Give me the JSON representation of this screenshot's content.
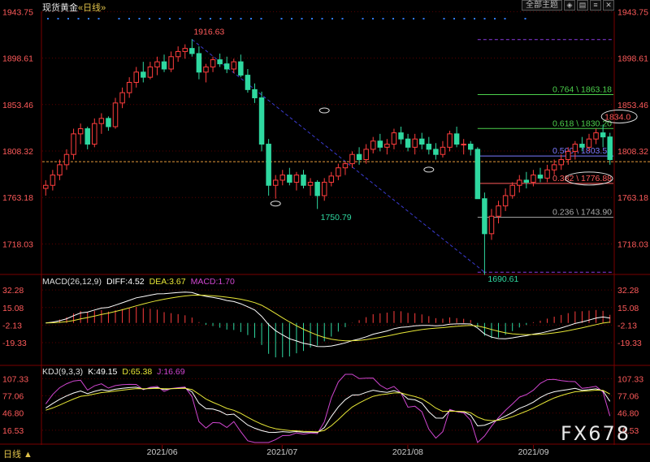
{
  "header": {
    "instrument": "现货黄金",
    "period": "«日线»",
    "menu_label": "全部主题",
    "icons": [
      "adjust-icon",
      "layers-icon",
      "menu-icon",
      "close-icon"
    ]
  },
  "colors": {
    "up": "#ff3d3d",
    "down": "#2fd8a0",
    "price_axis": "#ff5a5a",
    "grid": "#5a0000",
    "trend": "#3b3bd0",
    "dashed_ref": "#e59a3a",
    "diff": "#ffffff",
    "dea": "#e8e837",
    "macd": "#d046d0",
    "k": "#ffffff",
    "d": "#e8e837",
    "j": "#d046d0"
  },
  "chart_data": [
    {
      "type": "candlestick",
      "title": "现货黄金 «日线»",
      "y_ticks": [
        "1943.75",
        "1898.61",
        "1853.46",
        "1808.32",
        "1763.18",
        "1718.03"
      ],
      "x_ticks": [
        "2021/06",
        "2021/07",
        "2021/08",
        "2021/09"
      ],
      "ylim": [
        1690,
        1944
      ],
      "candles": [
        [
          1772,
          1780,
          1765,
          1775
        ],
        [
          1775,
          1790,
          1770,
          1785
        ],
        [
          1785,
          1800,
          1780,
          1795
        ],
        [
          1795,
          1810,
          1790,
          1805
        ],
        [
          1805,
          1830,
          1800,
          1825
        ],
        [
          1825,
          1835,
          1815,
          1830
        ],
        [
          1830,
          1832,
          1810,
          1815
        ],
        [
          1815,
          1840,
          1812,
          1835
        ],
        [
          1835,
          1845,
          1825,
          1840
        ],
        [
          1840,
          1842,
          1828,
          1832
        ],
        [
          1832,
          1860,
          1830,
          1855
        ],
        [
          1855,
          1870,
          1850,
          1865
        ],
        [
          1865,
          1880,
          1860,
          1875
        ],
        [
          1875,
          1890,
          1870,
          1885
        ],
        [
          1885,
          1895,
          1875,
          1880
        ],
        [
          1880,
          1895,
          1878,
          1890
        ],
        [
          1890,
          1900,
          1882,
          1895
        ],
        [
          1895,
          1902,
          1885,
          1888
        ],
        [
          1888,
          1905,
          1885,
          1900
        ],
        [
          1900,
          1910,
          1895,
          1905
        ],
        [
          1905,
          1912,
          1898,
          1908
        ],
        [
          1908,
          1917,
          1900,
          1903
        ],
        [
          1903,
          1910,
          1878,
          1885
        ],
        [
          1885,
          1893,
          1875,
          1890
        ],
        [
          1890,
          1900,
          1885,
          1897
        ],
        [
          1897,
          1903,
          1890,
          1893
        ],
        [
          1893,
          1900,
          1884,
          1888
        ],
        [
          1888,
          1898,
          1884,
          1895
        ],
        [
          1895,
          1902,
          1880,
          1882
        ],
        [
          1882,
          1888,
          1865,
          1868
        ],
        [
          1868,
          1874,
          1855,
          1860
        ],
        [
          1860,
          1866,
          1808,
          1815
        ],
        [
          1815,
          1820,
          1765,
          1775
        ],
        [
          1775,
          1785,
          1762,
          1780
        ],
        [
          1780,
          1790,
          1775,
          1785
        ],
        [
          1785,
          1792,
          1775,
          1778
        ],
        [
          1778,
          1788,
          1770,
          1785
        ],
        [
          1785,
          1790,
          1772,
          1775
        ],
        [
          1775,
          1782,
          1765,
          1778
        ],
        [
          1778,
          1780,
          1752,
          1765
        ],
        [
          1765,
          1782,
          1760,
          1778
        ],
        [
          1778,
          1788,
          1774,
          1784
        ],
        [
          1784,
          1796,
          1780,
          1792
        ],
        [
          1792,
          1798,
          1785,
          1796
        ],
        [
          1796,
          1808,
          1792,
          1805
        ],
        [
          1805,
          1812,
          1795,
          1800
        ],
        [
          1800,
          1815,
          1796,
          1810
        ],
        [
          1810,
          1822,
          1806,
          1818
        ],
        [
          1818,
          1825,
          1808,
          1812
        ],
        [
          1812,
          1820,
          1805,
          1815
        ],
        [
          1815,
          1830,
          1810,
          1826
        ],
        [
          1826,
          1832,
          1815,
          1820
        ],
        [
          1820,
          1825,
          1808,
          1812
        ],
        [
          1812,
          1825,
          1805,
          1820
        ],
        [
          1820,
          1826,
          1810,
          1815
        ],
        [
          1815,
          1822,
          1805,
          1810
        ],
        [
          1810,
          1816,
          1800,
          1805
        ],
        [
          1805,
          1818,
          1802,
          1812
        ],
        [
          1812,
          1828,
          1808,
          1825
        ],
        [
          1825,
          1832,
          1812,
          1815
        ],
        [
          1815,
          1820,
          1805,
          1815
        ],
        [
          1815,
          1818,
          1804,
          1810
        ],
        [
          1810,
          1812,
          1770,
          1762
        ],
        [
          1762,
          1768,
          1688,
          1728
        ],
        [
          1728,
          1752,
          1722,
          1745
        ],
        [
          1745,
          1760,
          1738,
          1755
        ],
        [
          1755,
          1772,
          1750,
          1765
        ],
        [
          1765,
          1778,
          1762,
          1775
        ],
        [
          1775,
          1785,
          1768,
          1780
        ],
        [
          1780,
          1788,
          1772,
          1778
        ],
        [
          1778,
          1790,
          1774,
          1785
        ],
        [
          1785,
          1792,
          1778,
          1782
        ],
        [
          1782,
          1795,
          1778,
          1790
        ],
        [
          1790,
          1800,
          1785,
          1795
        ],
        [
          1795,
          1805,
          1790,
          1800
        ],
        [
          1800,
          1812,
          1795,
          1808
        ],
        [
          1808,
          1818,
          1800,
          1815
        ],
        [
          1815,
          1822,
          1808,
          1812
        ],
        [
          1812,
          1825,
          1808,
          1820
        ],
        [
          1820,
          1830,
          1815,
          1826
        ],
        [
          1826,
          1834,
          1812,
          1822
        ],
        [
          1822,
          1826,
          1795,
          1800
        ]
      ],
      "labels": [
        {
          "text": "1916.63",
          "price": 1916.63,
          "index": 21,
          "color": "#ff5a5a"
        },
        {
          "text": "1750.79",
          "price": 1750.79,
          "index": 39,
          "color": "#2fd8a0"
        },
        {
          "text": "1690.61",
          "price": 1690.61,
          "index": 63,
          "color": "#2fd8a0"
        },
        {
          "text": "1834.0",
          "price": 1834.0,
          "index": 80,
          "color": "#ff5a5a"
        }
      ],
      "fibonacci": [
        {
          "ratio": "0.764",
          "price": "1863.18",
          "text": "0.764 \\ 1863.18",
          "value": 1863.18,
          "color": "#4cd04c"
        },
        {
          "ratio": "0.618",
          "price": "1830.20",
          "text": "0.618 \\ 1830.20",
          "value": 1830.2,
          "color": "#4cd04c"
        },
        {
          "ratio": "0.500",
          "price": "1803.54",
          "text": "0.500 \\ 1803.54",
          "value": 1803.54,
          "color": "#7a7aff"
        },
        {
          "ratio": "0.382",
          "price": "1776.88",
          "text": "0.382 \\ 1776.88",
          "value": 1776.88,
          "color": "#ff5a5a"
        },
        {
          "ratio": "0.236",
          "price": "1743.90",
          "text": "0.236 \\ 1743.90",
          "value": 1743.9,
          "color": "#aaaaaa"
        }
      ],
      "fib_top": 1916.63,
      "fib_bottom": 1690.61,
      "current_price_line": 1798
    },
    {
      "type": "bar+line",
      "title": "MACD(26,12,9)",
      "diff_label": "DIFF:4.52",
      "dea_label": "DEA:3.67",
      "macd_label": "MACD:1.70",
      "y_ticks": [
        "32.28",
        "15.08",
        "-2.13",
        "-19.33"
      ],
      "ylim": [
        -40,
        38
      ]
    },
    {
      "type": "line",
      "title": "KDJ(9,3,3)",
      "k_label": "K:49.15",
      "d_label": "D:65.38",
      "j_label": "J:16.69",
      "y_ticks": [
        "107.33",
        "77.06",
        "46.80",
        "16.53"
      ],
      "ylim": [
        -5,
        115
      ]
    }
  ],
  "footer": {
    "period_tab": "日线 ▲",
    "watermark": "FX678"
  }
}
